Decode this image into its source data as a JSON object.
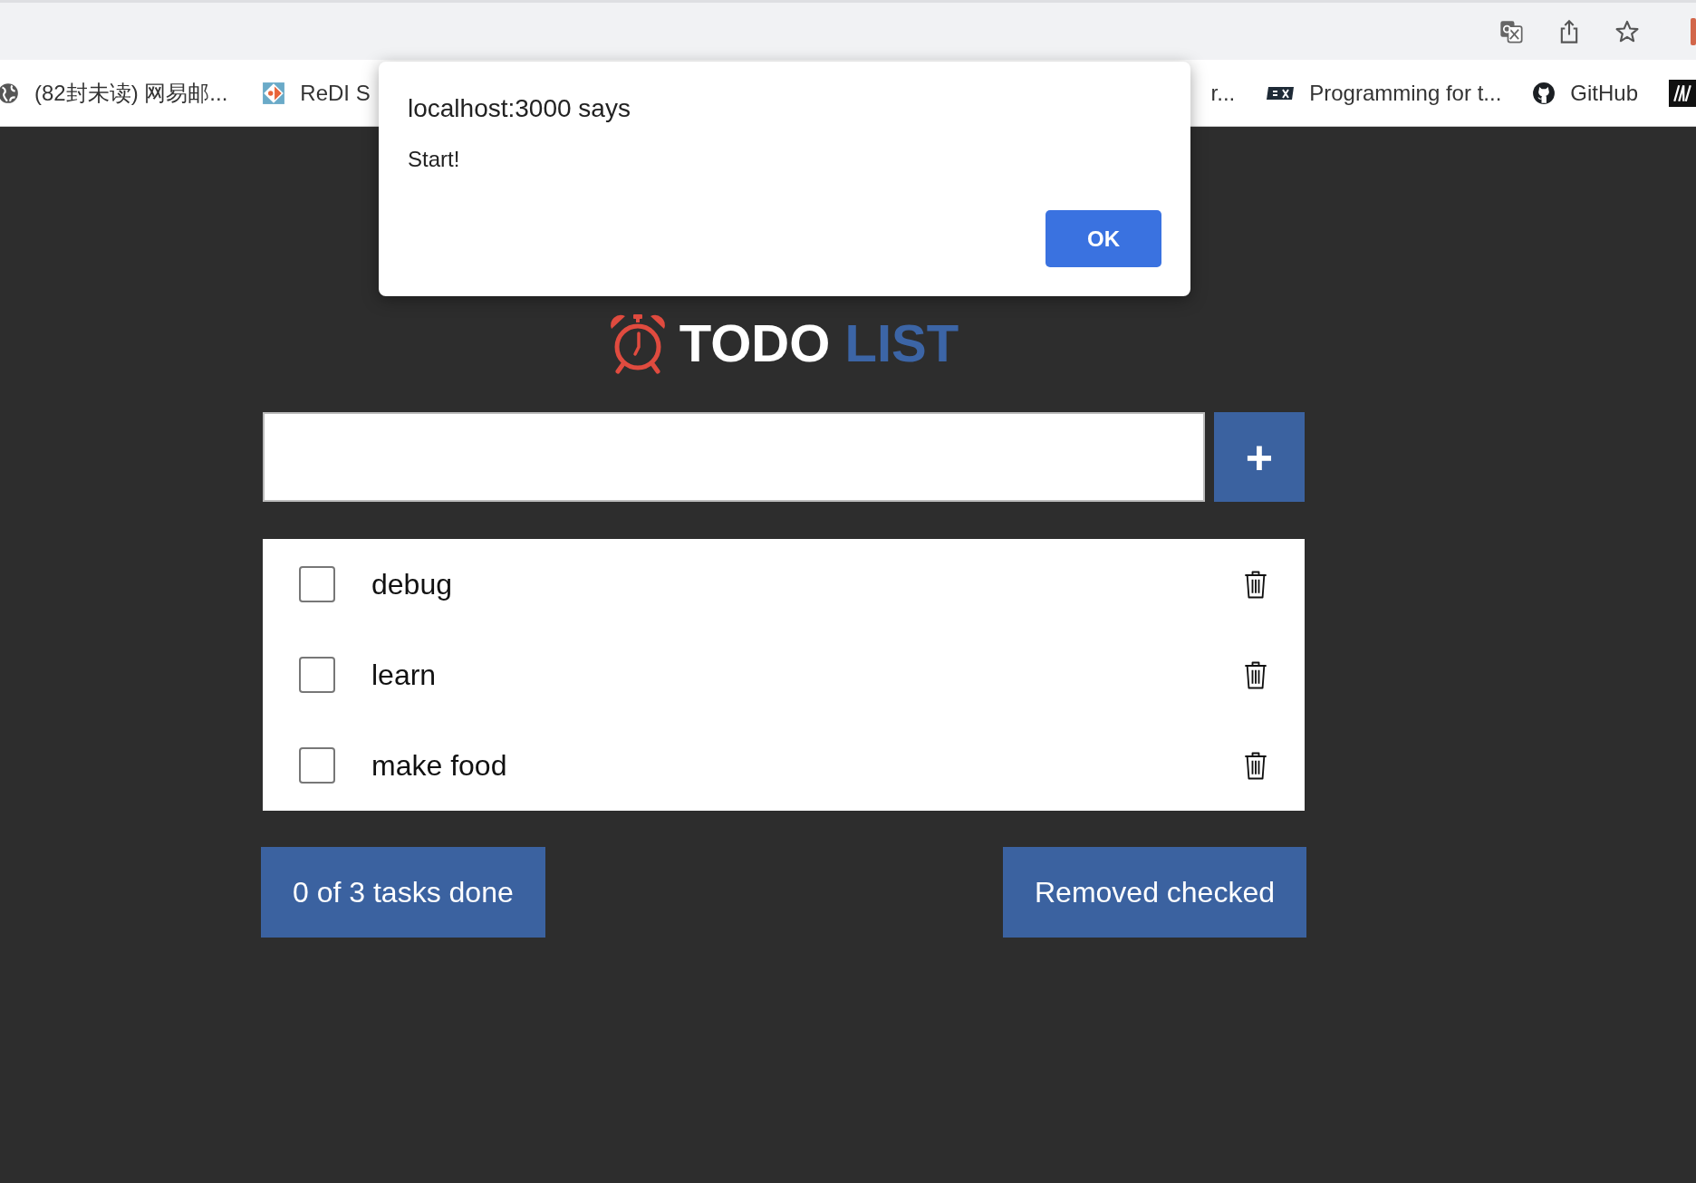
{
  "browser": {
    "bookmarks_left": [
      "(82封未读) 网易邮...",
      "ReDI S"
    ],
    "bookmarks_right": [
      "r...",
      "Programming for t...",
      "GitHub"
    ]
  },
  "dialog": {
    "title": "localhost:3000 says",
    "message": "Start!",
    "button": "OK"
  },
  "app": {
    "title_main": "TODO",
    "title_accent": "LIST",
    "add_button": "+",
    "tasks": [
      {
        "text": "debug",
        "checked": false
      },
      {
        "text": "learn",
        "checked": false
      },
      {
        "text": "make food",
        "checked": false
      }
    ],
    "status": "0 of 3 tasks done",
    "remove_button": "Removed checked"
  }
}
